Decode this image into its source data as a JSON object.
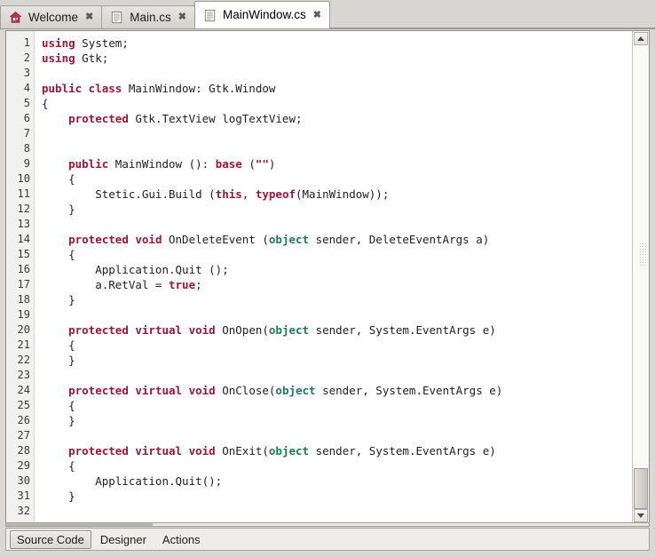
{
  "tabbar": {
    "tabs": [
      {
        "label": "Welcome",
        "icon": "home-icon",
        "close": "✖",
        "active": false
      },
      {
        "label": "Main.cs",
        "icon": "document-icon",
        "close": "✖",
        "active": false
      },
      {
        "label": "MainWindow.cs",
        "icon": "document-icon",
        "close": "✖",
        "active": true
      }
    ]
  },
  "editor": {
    "line_numbers": [
      "1",
      "2",
      "3",
      "4",
      "5",
      "6",
      "7",
      "8",
      "9",
      "10",
      "11",
      "12",
      "13",
      "14",
      "15",
      "16",
      "17",
      "18",
      "19",
      "20",
      "21",
      "22",
      "23",
      "24",
      "25",
      "26",
      "27",
      "28",
      "29",
      "30",
      "31",
      "32"
    ],
    "lines": [
      [
        {
          "t": "using",
          "c": "kw"
        },
        {
          "t": " System;",
          "c": ""
        }
      ],
      [
        {
          "t": "using",
          "c": "kw"
        },
        {
          "t": " Gtk;",
          "c": ""
        }
      ],
      [],
      [
        {
          "t": "public class",
          "c": "kw"
        },
        {
          "t": " MainWindow: Gtk.Window",
          "c": ""
        }
      ],
      [
        {
          "t": "{",
          "c": ""
        }
      ],
      [
        {
          "t": "    ",
          "c": ""
        },
        {
          "t": "protected",
          "c": "kw"
        },
        {
          "t": " Gtk.TextView logTextView;",
          "c": ""
        }
      ],
      [],
      [],
      [
        {
          "t": "    ",
          "c": ""
        },
        {
          "t": "public",
          "c": "kw"
        },
        {
          "t": " MainWindow (): ",
          "c": ""
        },
        {
          "t": "base",
          "c": "kw"
        },
        {
          "t": " (",
          "c": ""
        },
        {
          "t": "\"\"",
          "c": "kw"
        },
        {
          "t": ")",
          "c": ""
        }
      ],
      [
        {
          "t": "    {",
          "c": ""
        }
      ],
      [
        {
          "t": "        Stetic.Gui.Build (",
          "c": ""
        },
        {
          "t": "this",
          "c": "kw"
        },
        {
          "t": ", ",
          "c": ""
        },
        {
          "t": "typeof",
          "c": "kw"
        },
        {
          "t": "(MainWindow));",
          "c": ""
        }
      ],
      [
        {
          "t": "    }",
          "c": ""
        }
      ],
      [],
      [
        {
          "t": "    ",
          "c": ""
        },
        {
          "t": "protected void",
          "c": "kw"
        },
        {
          "t": " OnDeleteEvent (",
          "c": ""
        },
        {
          "t": "object",
          "c": "tp"
        },
        {
          "t": " sender, DeleteEventArgs a)",
          "c": ""
        }
      ],
      [
        {
          "t": "    {",
          "c": ""
        }
      ],
      [
        {
          "t": "        Application.Quit ();",
          "c": ""
        }
      ],
      [
        {
          "t": "        a.RetVal = ",
          "c": ""
        },
        {
          "t": "true",
          "c": "kw"
        },
        {
          "t": ";",
          "c": ""
        }
      ],
      [
        {
          "t": "    }",
          "c": ""
        }
      ],
      [],
      [
        {
          "t": "    ",
          "c": ""
        },
        {
          "t": "protected virtual void",
          "c": "kw"
        },
        {
          "t": " OnOpen(",
          "c": ""
        },
        {
          "t": "object",
          "c": "tp"
        },
        {
          "t": " sender, System.EventArgs e)",
          "c": ""
        }
      ],
      [
        {
          "t": "    {",
          "c": ""
        }
      ],
      [
        {
          "t": "    }",
          "c": ""
        }
      ],
      [],
      [
        {
          "t": "    ",
          "c": ""
        },
        {
          "t": "protected virtual void",
          "c": "kw"
        },
        {
          "t": " OnClose(",
          "c": ""
        },
        {
          "t": "object",
          "c": "tp"
        },
        {
          "t": " sender, System.EventArgs e)",
          "c": ""
        }
      ],
      [
        {
          "t": "    {",
          "c": ""
        }
      ],
      [
        {
          "t": "    }",
          "c": ""
        }
      ],
      [],
      [
        {
          "t": "    ",
          "c": ""
        },
        {
          "t": "protected virtual void",
          "c": "kw"
        },
        {
          "t": " OnExit(",
          "c": ""
        },
        {
          "t": "object",
          "c": "tp"
        },
        {
          "t": " sender, System.EventArgs e)",
          "c": ""
        }
      ],
      [
        {
          "t": "    {",
          "c": ""
        }
      ],
      [
        {
          "t": "        Application.Quit();",
          "c": ""
        }
      ],
      [
        {
          "t": "    }",
          "c": ""
        }
      ],
      []
    ],
    "colors": {
      "keyword": "#9e1636",
      "type": "#1f7a5a",
      "text": "#202020",
      "gutter_bg": "#f1f1ef",
      "background": "#ffffff"
    }
  },
  "viewbar": {
    "tabs": [
      {
        "label": "Source Code",
        "active": true
      },
      {
        "label": "Designer",
        "active": false
      },
      {
        "label": "Actions",
        "active": false
      }
    ]
  },
  "scrollbars": {
    "vertical": {
      "up_icon": "triangle-up-icon",
      "down_icon": "triangle-down-icon",
      "grip": "drag-grip-icon"
    },
    "horizontal": {
      "name": "horizontal-scrollbar"
    }
  }
}
